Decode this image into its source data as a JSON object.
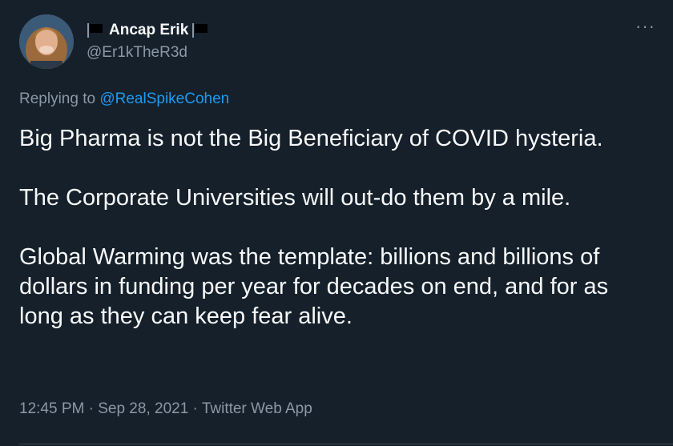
{
  "user": {
    "display_name": "Ancap Erik",
    "handle": "@Er1kTheR3d",
    "avatar_icon": "profile-photo",
    "flag_icon": "black-flag"
  },
  "reply": {
    "prefix": "Replying to",
    "mention": "@RealSpikeCohen"
  },
  "tweet": {
    "paragraphs": [
      "Big Pharma is not the Big Beneficiary of COVID hysteria.",
      "The Corporate Universities will out-do them by a mile.",
      "Global Warming was the template: billions and billions of dollars in funding per year for decades on end, and for as long as they can keep fear alive."
    ]
  },
  "meta": {
    "time": "12:45 PM",
    "separator": "·",
    "date": "Sep 28, 2021",
    "source": "Twitter Web App"
  },
  "more_label": "···",
  "colors": {
    "background": "#15202b",
    "text": "#f7f9f9",
    "secondary": "#8b98a5",
    "accent": "#1d9bf0"
  }
}
